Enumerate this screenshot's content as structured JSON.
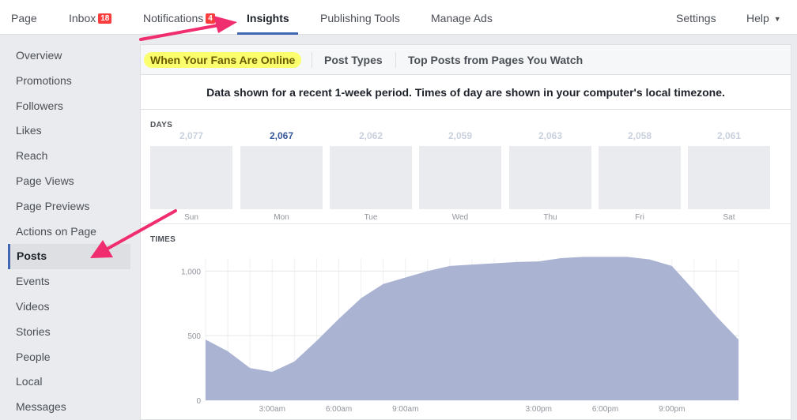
{
  "topnav": {
    "items": [
      {
        "label": "Page"
      },
      {
        "label": "Inbox",
        "badge": "18"
      },
      {
        "label": "Notifications",
        "badge": "4"
      },
      {
        "label": "Insights"
      },
      {
        "label": "Publishing Tools"
      },
      {
        "label": "Manage Ads"
      },
      {
        "label": "Settings"
      },
      {
        "label": "Help"
      }
    ]
  },
  "sidebar": {
    "items": [
      {
        "label": "Overview"
      },
      {
        "label": "Promotions"
      },
      {
        "label": "Followers"
      },
      {
        "label": "Likes"
      },
      {
        "label": "Reach"
      },
      {
        "label": "Page Views"
      },
      {
        "label": "Page Previews"
      },
      {
        "label": "Actions on Page"
      },
      {
        "label": "Posts"
      },
      {
        "label": "Events"
      },
      {
        "label": "Videos"
      },
      {
        "label": "Stories"
      },
      {
        "label": "People"
      },
      {
        "label": "Local"
      },
      {
        "label": "Messages"
      }
    ]
  },
  "tabs": {
    "items": [
      {
        "label": "When Your Fans Are Online"
      },
      {
        "label": "Post Types"
      },
      {
        "label": "Top Posts from Pages You Watch"
      }
    ]
  },
  "info_text": "Data shown for a recent 1-week period. Times of day are shown in your computer's local timezone.",
  "days_section": {
    "label": "DAYS",
    "days": [
      {
        "name": "Sun",
        "count": "2,077"
      },
      {
        "name": "Mon",
        "count": "2,067"
      },
      {
        "name": "Tue",
        "count": "2,062"
      },
      {
        "name": "Wed",
        "count": "2,059"
      },
      {
        "name": "Thu",
        "count": "2,063"
      },
      {
        "name": "Fri",
        "count": "2,058"
      },
      {
        "name": "Sat",
        "count": "2,061"
      }
    ]
  },
  "times_section": {
    "label": "TIMES"
  },
  "colors": {
    "accent": "#4267b2",
    "area_fill": "#aab4d2",
    "badge": "#fa3e3e",
    "highlight": "#fbff6e",
    "arrow": "#f02d6e"
  },
  "chart_data": {
    "type": "area",
    "x": [
      0,
      1,
      2,
      3,
      4,
      5,
      6,
      7,
      8,
      9,
      10,
      11,
      12,
      13,
      14,
      15,
      16,
      17,
      18,
      19,
      20,
      21,
      22,
      23
    ],
    "values": [
      470,
      380,
      250,
      220,
      300,
      460,
      630,
      790,
      900,
      950,
      1000,
      1040,
      1050,
      1060,
      1070,
      1075,
      1100,
      1110,
      1110,
      1110,
      1090,
      1040,
      850,
      650,
      470
    ],
    "x_tick_labels": [
      "3:00am",
      "6:00am",
      "9:00am",
      "3:00pm",
      "6:00pm",
      "9:00pm"
    ],
    "x_tick_hours": [
      3,
      6,
      9,
      15,
      18,
      21
    ],
    "y_tick_labels": [
      "0",
      "500",
      "1,000"
    ],
    "y_tick_values": [
      0,
      500,
      1000
    ],
    "ylim": [
      0,
      1100
    ],
    "xlabel": "",
    "ylabel": "",
    "title": ""
  }
}
